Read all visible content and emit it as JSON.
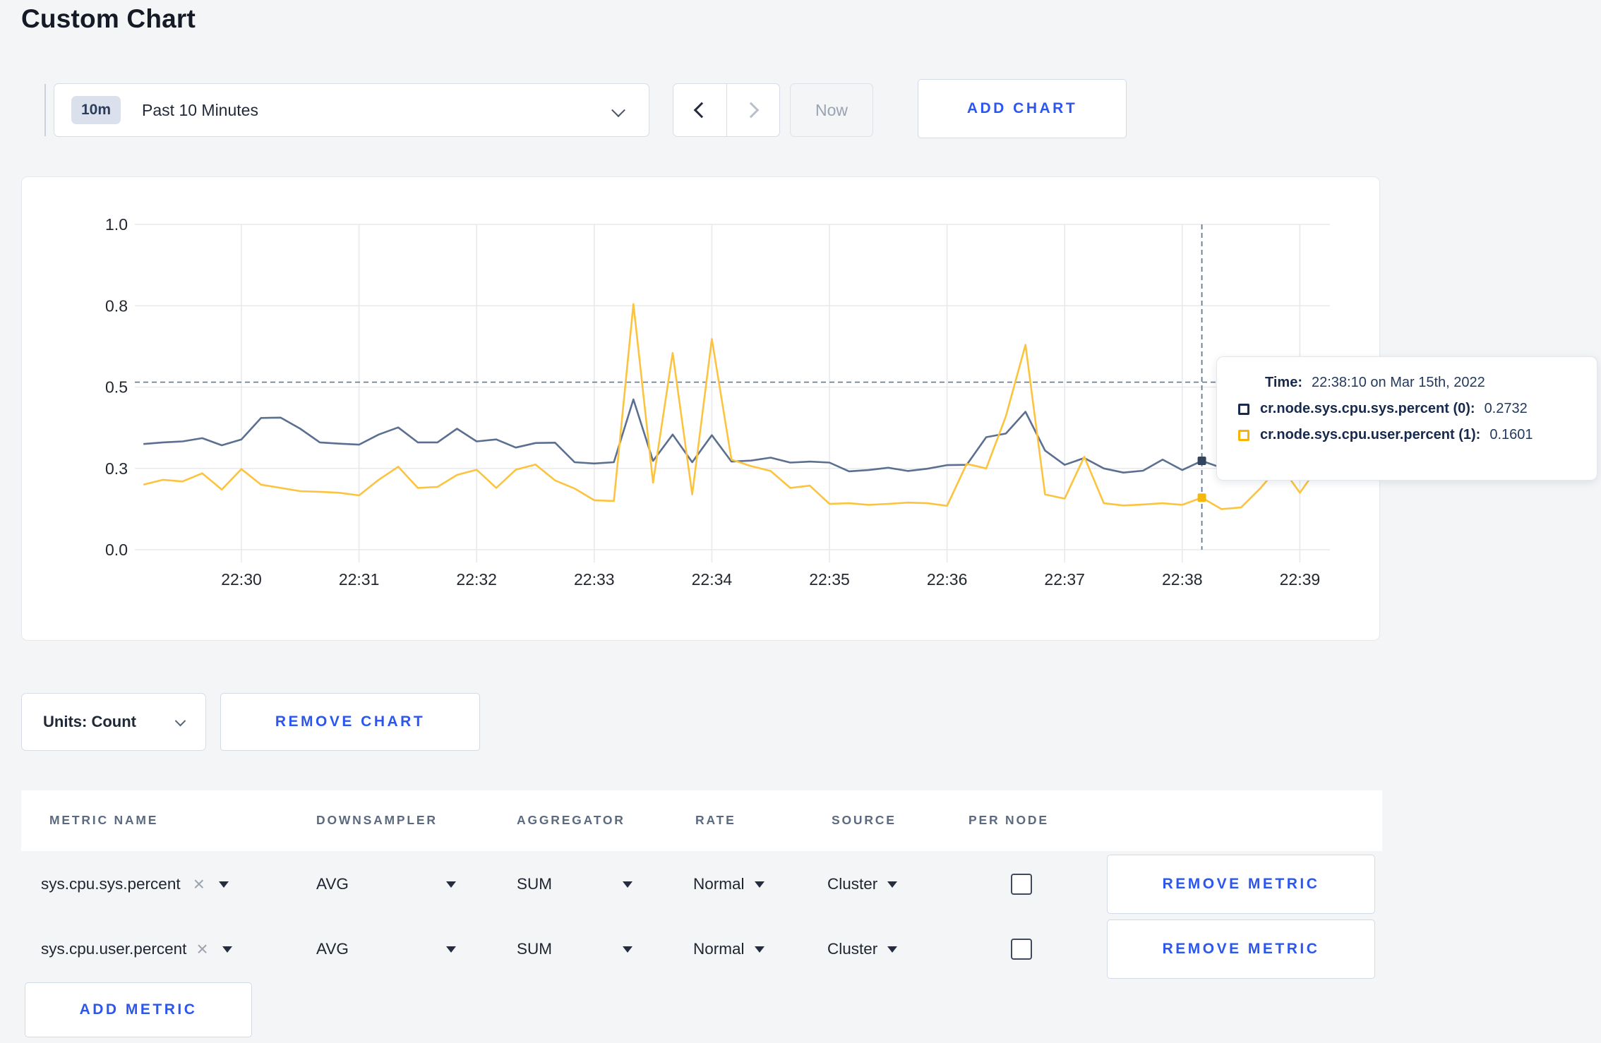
{
  "page": {
    "title": "Custom Chart"
  },
  "colors": {
    "action_blue": "#2c56f0",
    "series_sys_line": "#5b6f90",
    "series_user_line": "#fcc43e",
    "legend_sys": "#1b2b4d",
    "legend_user": "#f7b500",
    "page_background": "#f4f5f7",
    "card_background": "#ffffff"
  },
  "toolbar": {
    "time_badge": "10m",
    "time_label": "Past 10 Minutes",
    "now_label": "Now",
    "add_chart_label": "ADD CHART"
  },
  "chart_data": {
    "type": "line",
    "title": "",
    "xlabel": "",
    "ylabel": "",
    "grid": true,
    "x_start": "22:29:10",
    "interval_sec": 10,
    "start_offset_sec": 50,
    "x_ticks": [
      "22:30",
      "22:31",
      "22:32",
      "22:33",
      "22:34",
      "22:35",
      "22:36",
      "22:37",
      "22:38",
      "22:39"
    ],
    "ylim": [
      0,
      1
    ],
    "y_ticks": [
      {
        "value": 0,
        "label": "0.0"
      },
      {
        "value": 0.25,
        "label": "0.3"
      },
      {
        "value": 0.5,
        "label": "0.5"
      },
      {
        "value": 0.75,
        "label": "0.8"
      },
      {
        "value": 1,
        "label": "1.0"
      }
    ],
    "series": [
      {
        "name": "cr.node.sys.cpu.sys.percent",
        "color": "#5b6f90",
        "marker_color": "#33445f",
        "values": [
          0.325,
          0.33,
          0.333,
          0.343,
          0.321,
          0.339,
          0.405,
          0.406,
          0.372,
          0.33,
          0.326,
          0.323,
          0.354,
          0.376,
          0.33,
          0.33,
          0.372,
          0.333,
          0.339,
          0.314,
          0.328,
          0.329,
          0.269,
          0.265,
          0.269,
          0.462,
          0.273,
          0.354,
          0.269,
          0.352,
          0.271,
          0.274,
          0.283,
          0.268,
          0.271,
          0.268,
          0.241,
          0.245,
          0.252,
          0.242,
          0.249,
          0.26,
          0.261,
          0.346,
          0.357,
          0.424,
          0.305,
          0.261,
          0.282,
          0.25,
          0.237,
          0.243,
          0.277,
          0.245,
          0.2732,
          0.252,
          0.27,
          0.28,
          0.29,
          0.3,
          0.3
        ]
      },
      {
        "name": "cr.node.sys.cpu.user.percent",
        "color": "#fcc43e",
        "marker_color": "#f5b70a",
        "values": [
          0.2,
          0.215,
          0.21,
          0.235,
          0.185,
          0.248,
          0.2,
          0.19,
          0.18,
          0.178,
          0.175,
          0.167,
          0.215,
          0.255,
          0.19,
          0.193,
          0.23,
          0.246,
          0.19,
          0.246,
          0.262,
          0.213,
          0.188,
          0.152,
          0.15,
          0.755,
          0.206,
          0.605,
          0.17,
          0.648,
          0.277,
          0.257,
          0.242,
          0.19,
          0.197,
          0.141,
          0.143,
          0.138,
          0.141,
          0.145,
          0.143,
          0.135,
          0.264,
          0.25,
          0.41,
          0.63,
          0.17,
          0.157,
          0.286,
          0.143,
          0.136,
          0.139,
          0.143,
          0.138,
          0.1601,
          0.125,
          0.13,
          0.19,
          0.26,
          0.175,
          0.26
        ]
      }
    ],
    "hover": {
      "index": 54,
      "time": "22:38:10 on Mar 15th, 2022",
      "guideline_y_value": 0.515
    },
    "legend_position": "tooltip"
  },
  "tooltip": {
    "time_label": "Time:",
    "time_value": "22:38:10 on Mar 15th, 2022",
    "series": [
      {
        "name": "cr.node.sys.cpu.sys.percent (0):",
        "value": "0.2732"
      },
      {
        "name": "cr.node.sys.cpu.user.percent (1):",
        "value": "0.1601"
      }
    ]
  },
  "controls": {
    "units_label": "Units: Count",
    "remove_chart_label": "REMOVE CHART",
    "remove_metric_label": "REMOVE METRIC",
    "add_metric_label": "ADD METRIC"
  },
  "metrics_table": {
    "headers": [
      "METRIC NAME",
      "DOWNSAMPLER",
      "AGGREGATOR",
      "RATE",
      "SOURCE",
      "PER NODE"
    ],
    "rows": [
      {
        "metric": "sys.cpu.sys.percent",
        "downsampler": "AVG",
        "aggregator": "SUM",
        "rate": "Normal",
        "source": "Cluster",
        "per_node_checked": false
      },
      {
        "metric": "sys.cpu.user.percent",
        "downsampler": "AVG",
        "aggregator": "SUM",
        "rate": "Normal",
        "source": "Cluster",
        "per_node_checked": false
      }
    ]
  },
  "icons": {
    "time_dropdown": "chevron-down-icon",
    "prev": "chevron-left-icon",
    "next": "chevron-right-icon",
    "units": "chevron-down-icon",
    "clear_metric": "x-icon",
    "select_caret": "caret-down-icon"
  }
}
